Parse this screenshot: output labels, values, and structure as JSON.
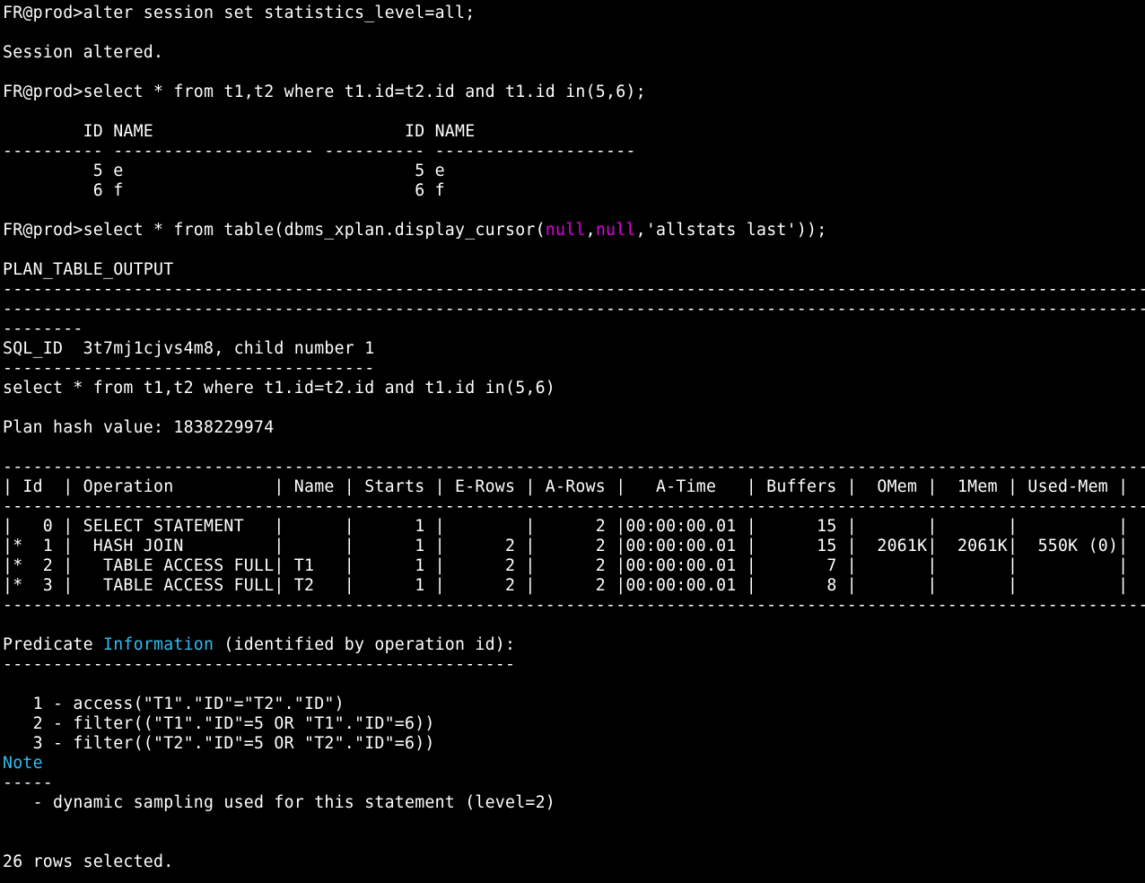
{
  "terminal": {
    "background": "#000000",
    "foreground": "#ffffff",
    "highlight_colors": {
      "keyword_magenta": "#e000e0",
      "keyword_cyan": "#33bbee"
    },
    "lines": [
      {
        "segs": [
          {
            "t": "FR@prod>alter session set statistics_level=all;"
          }
        ]
      },
      {
        "segs": [
          {
            "t": ""
          }
        ]
      },
      {
        "segs": [
          {
            "t": "Session altered."
          }
        ]
      },
      {
        "segs": [
          {
            "t": ""
          }
        ]
      },
      {
        "segs": [
          {
            "t": "FR@prod>select * from t1,t2 where t1.id=t2.id and t1.id in(5,6);"
          }
        ]
      },
      {
        "segs": [
          {
            "t": ""
          }
        ]
      },
      {
        "segs": [
          {
            "t": "        ID NAME                         ID NAME"
          }
        ]
      },
      {
        "segs": [
          {
            "t": "---------- -------------------- ---------- --------------------"
          }
        ]
      },
      {
        "segs": [
          {
            "t": "         5 e                             5 e"
          }
        ]
      },
      {
        "segs": [
          {
            "t": "         6 f                             6 f"
          }
        ]
      },
      {
        "segs": [
          {
            "t": ""
          }
        ]
      },
      {
        "segs": [
          {
            "t": "FR@prod>select * from table(dbms_xplan.display_cursor("
          },
          {
            "t": "null",
            "c": "hl"
          },
          {
            "t": ","
          },
          {
            "t": "null",
            "c": "hl"
          },
          {
            "t": ",'allstats last'));"
          }
        ]
      },
      {
        "segs": [
          {
            "t": ""
          }
        ]
      },
      {
        "segs": [
          {
            "t": "PLAN_TABLE_OUTPUT"
          }
        ]
      },
      {
        "segs": [
          {
            "t": "------------------------------------------------------------------------------------------------------------------------"
          }
        ]
      },
      {
        "segs": [
          {
            "t": "------------------------------------------------------------------------------------------------------------------------"
          }
        ]
      },
      {
        "segs": [
          {
            "t": "--------"
          }
        ]
      },
      {
        "segs": [
          {
            "t": "SQL_ID  3t7mj1cjvs4m8, child number 1"
          }
        ]
      },
      {
        "segs": [
          {
            "t": "-------------------------------------"
          }
        ]
      },
      {
        "segs": [
          {
            "t": "select * from t1,t2 where t1.id=t2.id and t1.id in(5,6)"
          }
        ]
      },
      {
        "segs": [
          {
            "t": ""
          }
        ]
      },
      {
        "segs": [
          {
            "t": "Plan hash value: 1838229974"
          }
        ]
      },
      {
        "segs": [
          {
            "t": ""
          }
        ]
      },
      {
        "segs": [
          {
            "t": "-------------------------------------------------------------------------------------------------------------------"
          }
        ]
      },
      {
        "segs": [
          {
            "t": "| Id  | Operation          | Name | Starts | E-Rows | A-Rows |   A-Time   | Buffers |  OMem |  1Mem | Used-Mem |"
          }
        ]
      },
      {
        "segs": [
          {
            "t": "-------------------------------------------------------------------------------------------------------------------"
          }
        ]
      },
      {
        "segs": [
          {
            "t": "|   0 | SELECT STATEMENT   |      |      1 |        |      2 |00:00:00.01 |      15 |       |       |          |"
          }
        ]
      },
      {
        "segs": [
          {
            "t": "|*  1 |  HASH JOIN         |      |      1 |      2 |      2 |00:00:00.01 |      15 |  2061K|  2061K|  550K (0)|"
          }
        ]
      },
      {
        "segs": [
          {
            "t": "|*  2 |   TABLE ACCESS FULL| T1   |      1 |      2 |      2 |00:00:00.01 |       7 |       |       |          |"
          }
        ]
      },
      {
        "segs": [
          {
            "t": "|*  3 |   TABLE ACCESS FULL| T2   |      1 |      2 |      2 |00:00:00.01 |       8 |       |       |          |"
          }
        ]
      },
      {
        "segs": [
          {
            "t": "-------------------------------------------------------------------------------------------------------------------"
          }
        ]
      },
      {
        "segs": [
          {
            "t": ""
          }
        ]
      },
      {
        "segs": [
          {
            "t": "Predicate "
          },
          {
            "t": "Information",
            "c": "cy"
          },
          {
            "t": " (identified by operation id):"
          }
        ]
      },
      {
        "segs": [
          {
            "t": "---------------------------------------------------"
          }
        ]
      },
      {
        "segs": [
          {
            "t": ""
          }
        ]
      },
      {
        "segs": [
          {
            "t": "   1 - access(\"T1\".\"ID\"=\"T2\".\"ID\")"
          }
        ]
      },
      {
        "segs": [
          {
            "t": "   2 - filter((\"T1\".\"ID\"=5 OR \"T1\".\"ID\"=6))"
          }
        ]
      },
      {
        "segs": [
          {
            "t": "   3 - filter((\"T2\".\"ID\"=5 OR \"T2\".\"ID\"=6))"
          }
        ]
      },
      {
        "segs": [
          {
            "t": "Note",
            "c": "cy"
          }
        ]
      },
      {
        "segs": [
          {
            "t": "-----"
          }
        ]
      },
      {
        "segs": [
          {
            "t": "   - dynamic sampling used for this statement (level=2)"
          }
        ]
      },
      {
        "segs": [
          {
            "t": ""
          }
        ]
      },
      {
        "segs": [
          {
            "t": ""
          }
        ]
      },
      {
        "segs": [
          {
            "t": "26 rows selected."
          }
        ]
      }
    ]
  }
}
